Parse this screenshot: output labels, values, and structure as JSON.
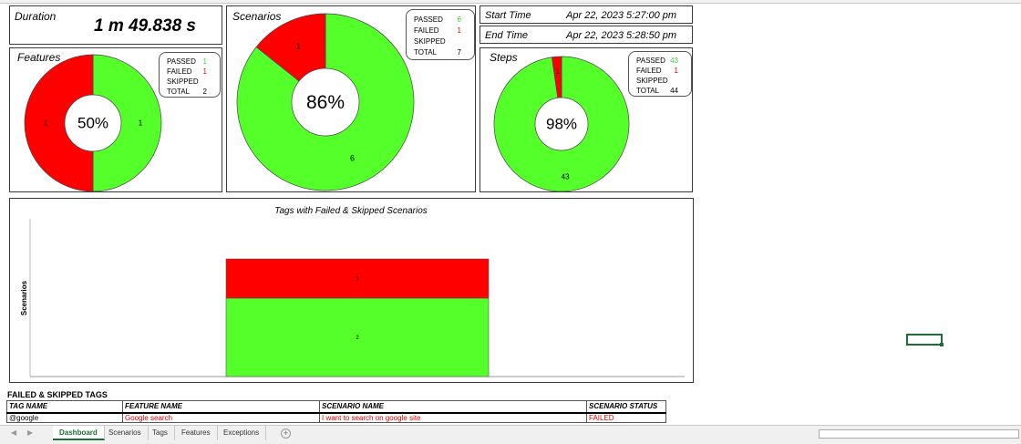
{
  "duration": {
    "label": "Duration",
    "value": "1 m 49.838 s"
  },
  "start_time": {
    "label": "Start Time",
    "value": "Apr 22, 2023 5:27:00 pm"
  },
  "end_time": {
    "label": "End Time",
    "value": "Apr 22, 2023 5:28:50 pm"
  },
  "features": {
    "title": "Features",
    "percent": "50%",
    "passed": 1,
    "failed": 1,
    "skipped": "",
    "total": 2,
    "passed_label": "1",
    "failed_label": "1",
    "legend": {
      "passed": "PASSED",
      "failed": "FAILED",
      "skipped": "SKIPPED",
      "total": "TOTAL"
    }
  },
  "scenarios": {
    "title": "Scenarios",
    "percent": "86%",
    "passed": 6,
    "failed": 1,
    "skipped": "",
    "total": 7,
    "passed_label": "6",
    "failed_label": "1",
    "legend": {
      "passed": "PASSED",
      "failed": "FAILED",
      "skipped": "SKIPPED",
      "total": "TOTAL"
    }
  },
  "steps": {
    "title": "Steps",
    "percent": "98%",
    "passed": 43,
    "failed": 1,
    "skipped": "",
    "total": 44,
    "passed_label": "43",
    "failed_label": "1",
    "legend": {
      "passed": "PASSED",
      "failed": "FAILED",
      "skipped": "SKIPPED",
      "total": "TOTAL"
    }
  },
  "colors": {
    "passed": "#55ff2a",
    "failed": "#ff0000",
    "passed_text": "#3cd13c",
    "failed_text": "#e00000",
    "border": "#3a3a3a"
  },
  "chart_data": {
    "type": "bar",
    "title": "Tags with Failed & Skipped Scenarios",
    "ylabel": "Scenarios",
    "xlabel": "",
    "categories": [
      ""
    ],
    "stacked": true,
    "series": [
      {
        "values": [
          2
        ],
        "color": "#55ff2a"
      },
      {
        "values": [
          1
        ],
        "color": "#ff0000"
      }
    ]
  },
  "failed_table": {
    "title": "FAILED & SKIPPED TAGS",
    "headers": [
      "TAG NAME",
      "FEATURE NAME",
      "SCENARIO NAME",
      "SCENARIO STATUS"
    ],
    "rows": [
      [
        "@google",
        "Google search",
        "I want to search on google site",
        "FAILED"
      ]
    ]
  },
  "sheet_tabs": [
    "Dashboard",
    "Scenarios",
    "Tags",
    "Features",
    "Exceptions"
  ],
  "active_tab": "Dashboard",
  "icons": {
    "prev": "chevron-left-icon",
    "next": "chevron-right-icon",
    "add": "plus-icon"
  }
}
